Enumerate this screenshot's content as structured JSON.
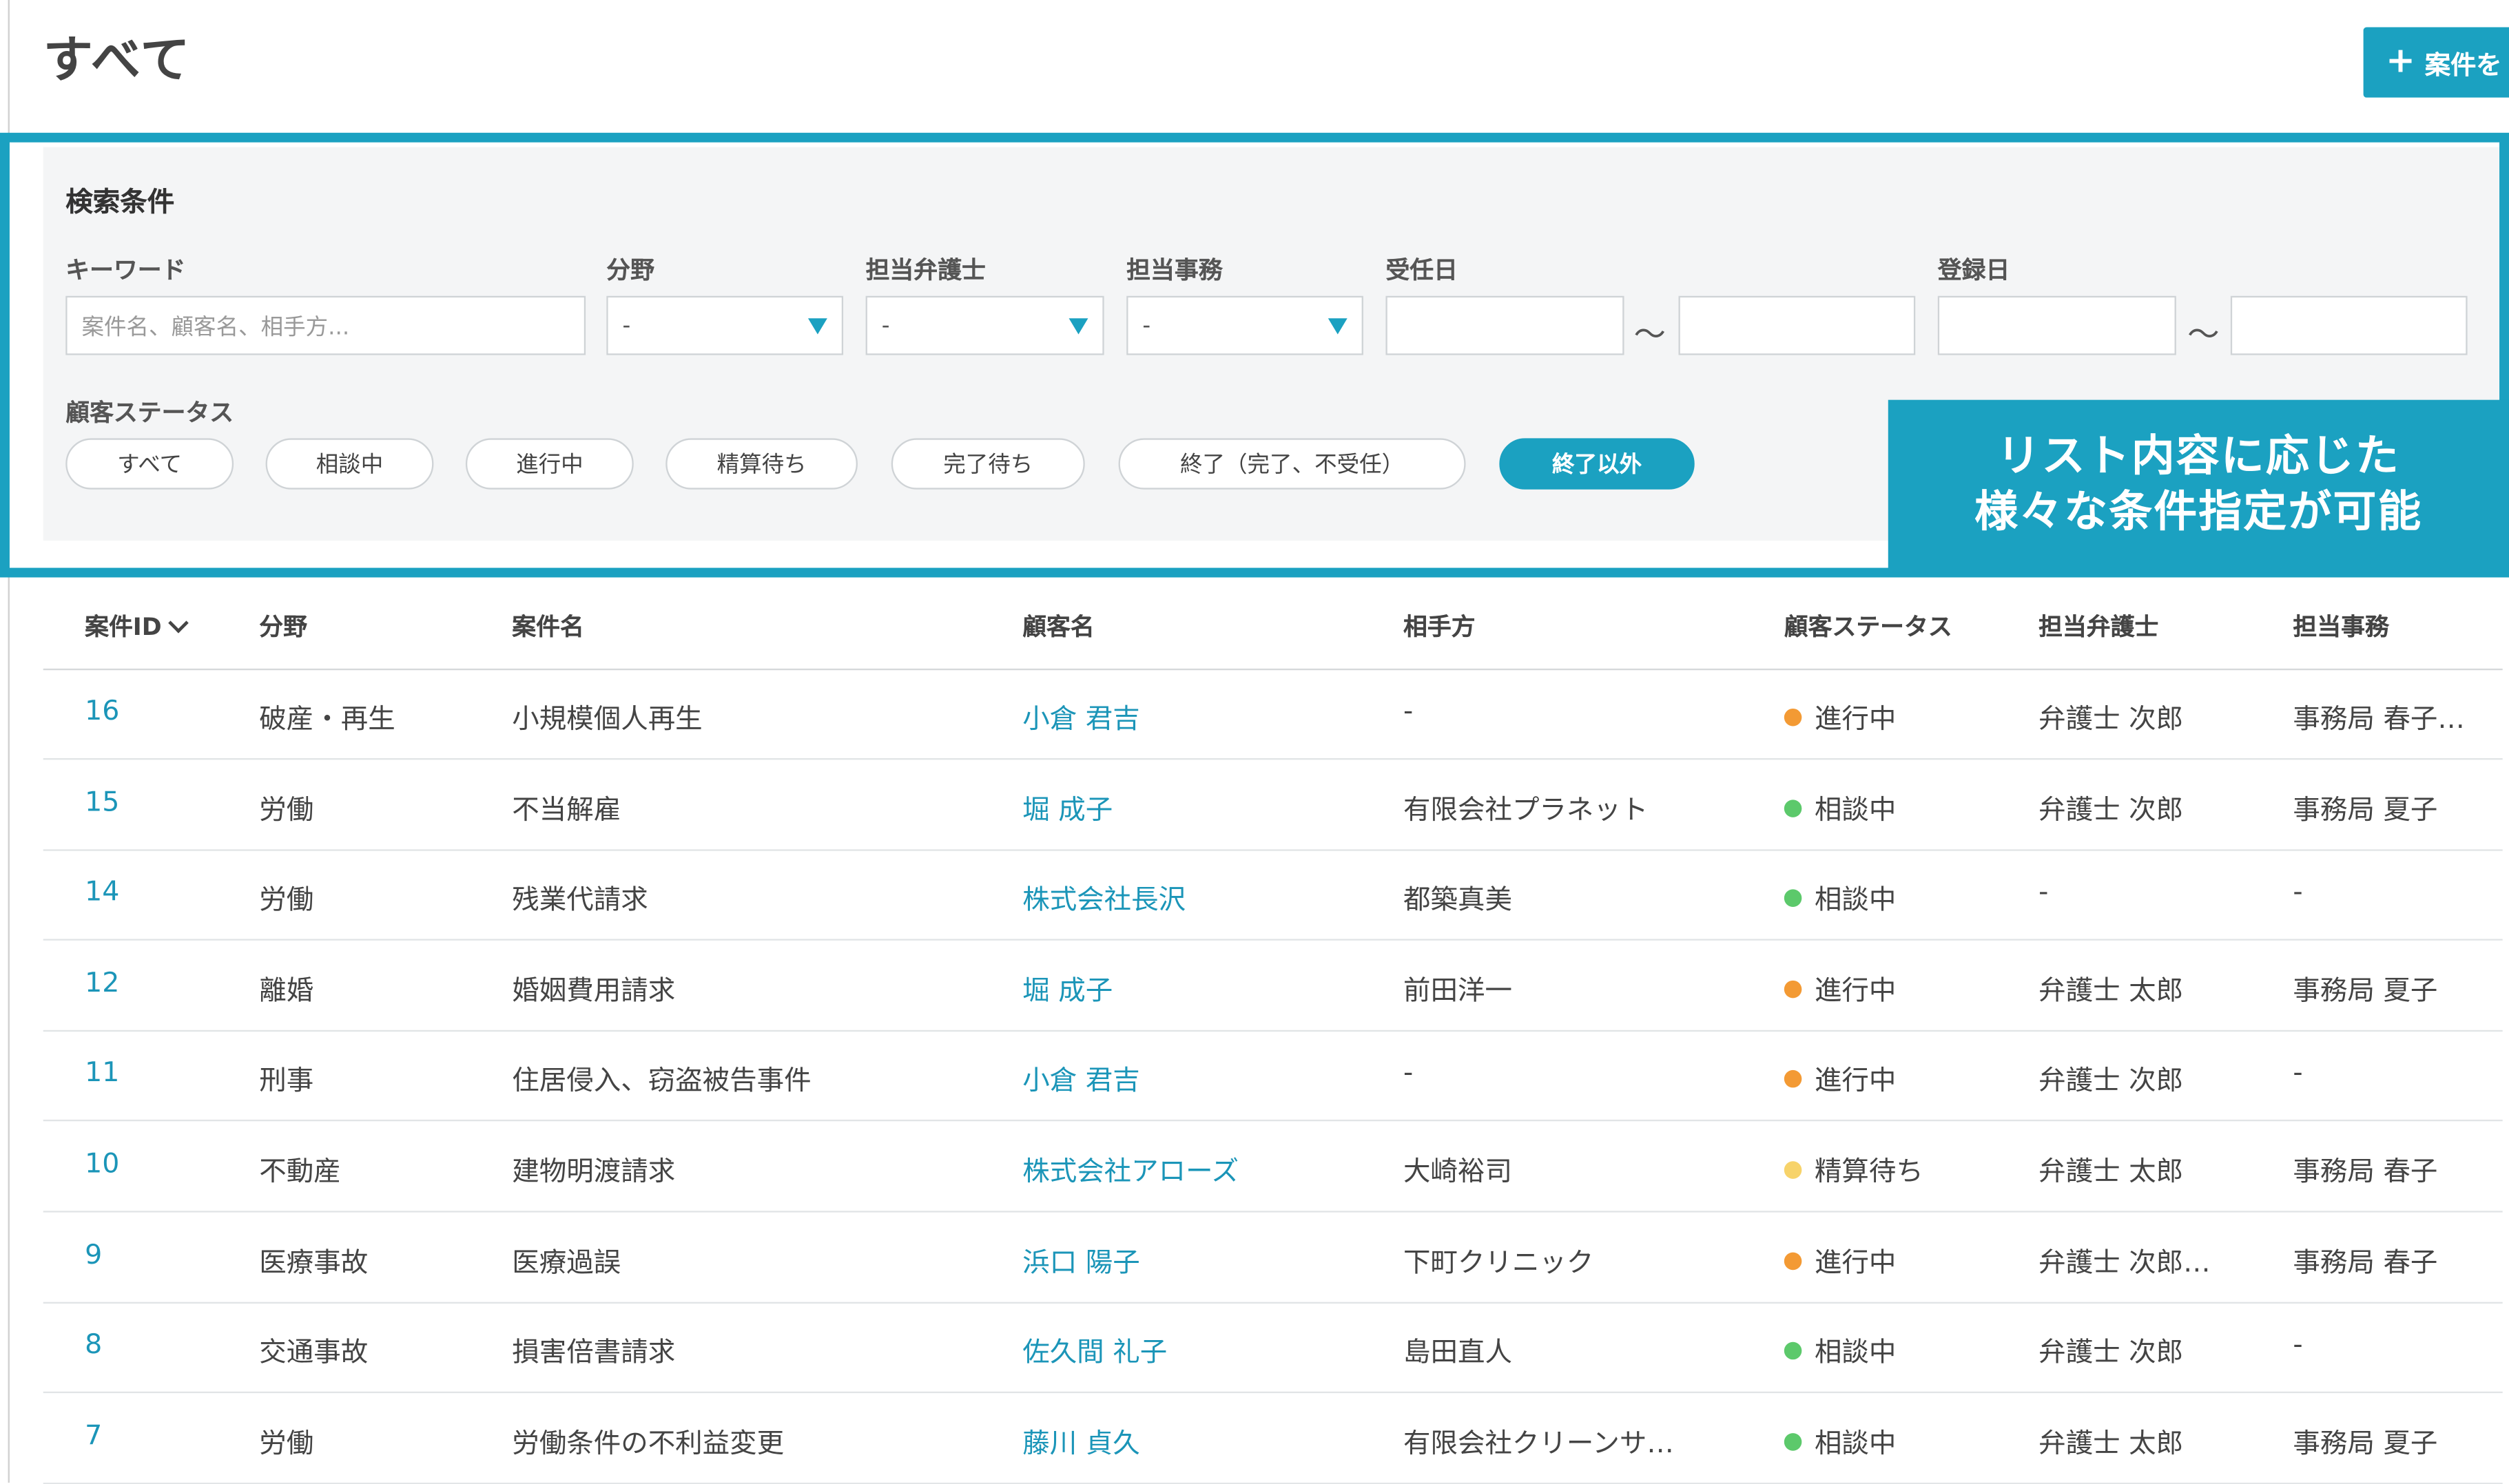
{
  "header": {
    "title": "すべて",
    "add_button_label": "案件を"
  },
  "search": {
    "title": "検索条件",
    "keyword_label": "キーワード",
    "keyword_placeholder": "案件名、顧客名、相手方...",
    "field_label": "分野",
    "field_value": "-",
    "lawyer_label": "担当弁護士",
    "lawyer_value": "-",
    "office_label": "担当事務",
    "office_value": "-",
    "accepted_label": "受任日",
    "registered_label": "登録日",
    "range_sep": "〜",
    "status_label": "顧客ステータス",
    "status_filters": [
      "すべて",
      "相談中",
      "進行中",
      "精算待ち",
      "完了待ち",
      "終了（完了、不受任）",
      "終了以外"
    ],
    "active_status": "終了以外"
  },
  "callout": {
    "line1": "リスト内容に応じた",
    "line2": "様々な条件指定が可能"
  },
  "table": {
    "headers": [
      "案件ID",
      "分野",
      "案件名",
      "顧客名",
      "相手方",
      "顧客ステータス",
      "担当弁護士",
      "担当事務"
    ],
    "rows": [
      {
        "id": "16",
        "field": "破産・再生",
        "name": "小規模個人再生",
        "client": "小倉 君吉",
        "opponent": "-",
        "status": "進行中",
        "status_color": "#f39a34",
        "lawyer": "弁護士 次郎",
        "office": "事務局 春子…"
      },
      {
        "id": "15",
        "field": "労働",
        "name": "不当解雇",
        "client": "堀 成子",
        "opponent": "有限会社プラネット",
        "status": "相談中",
        "status_color": "#5cc96b",
        "lawyer": "弁護士 次郎",
        "office": "事務局 夏子"
      },
      {
        "id": "14",
        "field": "労働",
        "name": "残業代請求",
        "client": "株式会社長沢",
        "opponent": "都築真美",
        "status": "相談中",
        "status_color": "#5cc96b",
        "lawyer": "-",
        "office": "-"
      },
      {
        "id": "12",
        "field": "離婚",
        "name": "婚姻費用請求",
        "client": "堀 成子",
        "opponent": "前田洋一",
        "status": "進行中",
        "status_color": "#f39a34",
        "lawyer": "弁護士 太郎",
        "office": "事務局 夏子"
      },
      {
        "id": "11",
        "field": "刑事",
        "name": "住居侵入、窃盗被告事件",
        "client": "小倉 君吉",
        "opponent": "-",
        "status": "進行中",
        "status_color": "#f39a34",
        "lawyer": "弁護士 次郎",
        "office": "-"
      },
      {
        "id": "10",
        "field": "不動産",
        "name": "建物明渡請求",
        "client": "株式会社アローズ",
        "opponent": "大崎裕司",
        "status": "精算待ち",
        "status_color": "#f7d36a",
        "lawyer": "弁護士 太郎",
        "office": "事務局 春子"
      },
      {
        "id": "9",
        "field": "医療事故",
        "name": "医療過誤",
        "client": "浜口 陽子",
        "opponent": "下町クリニック",
        "status": "進行中",
        "status_color": "#f39a34",
        "lawyer": "弁護士 次郎…",
        "office": "事務局 春子"
      },
      {
        "id": "8",
        "field": "交通事故",
        "name": "損害倍書請求",
        "client": "佐久間 礼子",
        "opponent": "島田直人",
        "status": "相談中",
        "status_color": "#5cc96b",
        "lawyer": "弁護士 次郎",
        "office": "-"
      },
      {
        "id": "7",
        "field": "労働",
        "name": "労働条件の不利益変更",
        "client": "藤川 貞久",
        "opponent": "有限会社クリーンサ…",
        "status": "相談中",
        "status_color": "#5cc96b",
        "lawyer": "弁護士 太郎",
        "office": "事務局 夏子"
      }
    ]
  },
  "colors": {
    "accent": "#1ba1c1",
    "link": "#1b95b8",
    "panel_bg": "#f4f5f6"
  }
}
